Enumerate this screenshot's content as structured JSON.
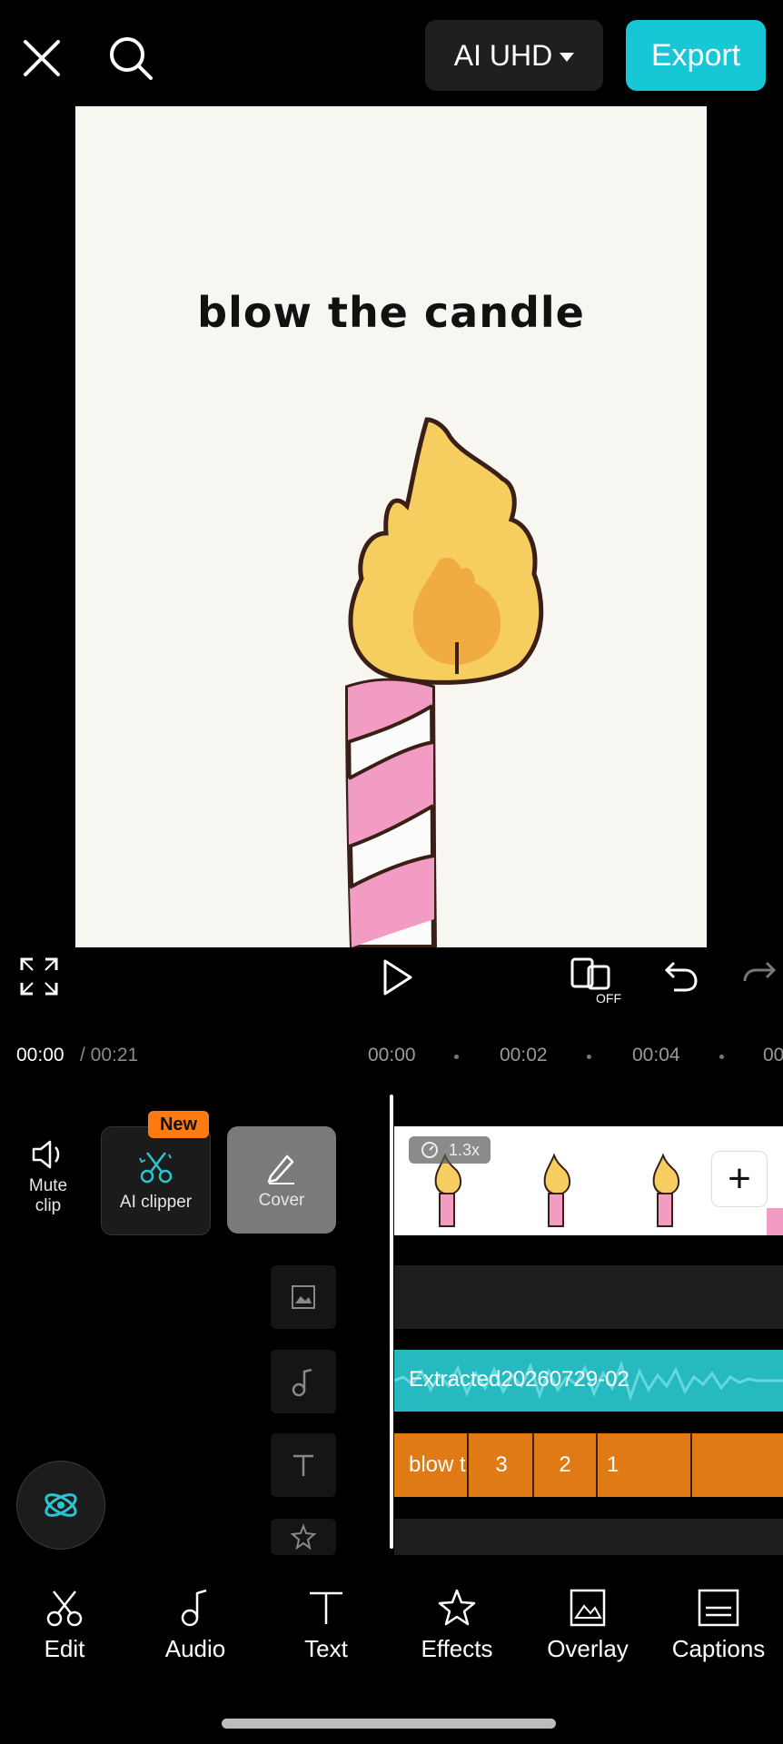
{
  "topbar": {
    "quality_label": "AI UHD",
    "export_label": "Export"
  },
  "preview": {
    "title": "blow the candle"
  },
  "timeline": {
    "current_time": "00:00",
    "total_time": "/ 00:21",
    "ticks": [
      "00:00",
      "00:02",
      "00:04",
      "00"
    ]
  },
  "tools": {
    "mute_label": "Mute\nclip",
    "ai_clipper_label": "AI clipper",
    "new_badge": "New",
    "cover_label": "Cover"
  },
  "tracks": {
    "speed": "1.3x",
    "audio_name": "Extracted20260729-02",
    "text_segments": [
      "blow t",
      "3",
      "2",
      "1"
    ]
  },
  "nav": {
    "items": [
      "Edit",
      "Audio",
      "Text",
      "Effects",
      "Overlay",
      "Captions"
    ]
  },
  "colors": {
    "accent": "#17c7d6",
    "audio_track": "#27b9c0",
    "text_track": "#e07a14",
    "new_badge": "#ff7a10"
  }
}
